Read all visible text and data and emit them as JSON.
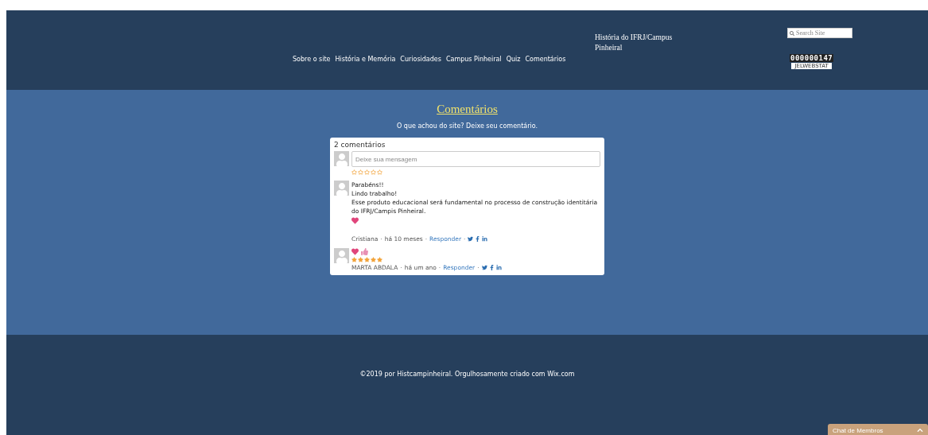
{
  "header": {
    "site_title": "História do IFRJ/Campus Pinheiral",
    "nav": [
      "Sobre o site",
      "História e Memória",
      "Curiosidades",
      "Campus Pinheiral",
      "Quiz",
      "Comentários"
    ],
    "search": {
      "placeholder": "Search Site"
    },
    "counter": {
      "value": "000000147",
      "label": "JELWEBSTAT"
    }
  },
  "main": {
    "title": "Comentários",
    "subtitle": "O que achou do site? Deixe seu comentário.",
    "comments_widget": {
      "count": "2 comentários",
      "input": {
        "placeholder": "Deixe sua mensagem",
        "stars": 0
      },
      "comments": [
        {
          "lines": [
            "Parabéns!!",
            "Lindo trabalho!",
            "Esse produto educacional será fundamental no processo de construção identitária do IFRJ/Campis Pinheiral."
          ],
          "heart": true,
          "thumbs_up": false,
          "author": "Cristiana",
          "time": "há 10 meses",
          "reply": "Responder",
          "separators": [
            "·",
            "·",
            "·"
          ]
        },
        {
          "heart": true,
          "thumbs_up": true,
          "stars": 5,
          "author": "MARTA ABDALA",
          "time": "há um ano",
          "reply": "Responder",
          "separators": [
            "·",
            "·",
            "·"
          ]
        }
      ]
    }
  },
  "footer": {
    "text": "©2019 por Histcampinheiral. Orgulhosamente criado com Wix.com"
  },
  "chat": {
    "label": "Chat de Membros",
    "expanded": false
  }
}
